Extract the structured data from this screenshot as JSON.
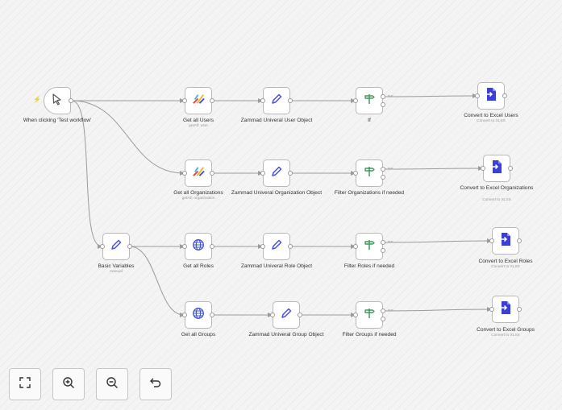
{
  "nodes": {
    "trigger": {
      "label": "When clicking 'Test workflow'",
      "icon": "cursor-icon"
    },
    "get_users": {
      "label": "Get all Users",
      "sub": "getAll: user",
      "icon": "zammad-logo-icon"
    },
    "zam_user": {
      "label": "Zammad Univeral User Object",
      "icon": "pencil-icon"
    },
    "if_node": {
      "label": "If",
      "icon": "signpost-icon"
    },
    "xl_users": {
      "label": "Convert to Excel Users",
      "sub": "Convert to XLSX",
      "icon": "file-convert-icon"
    },
    "get_orgs": {
      "label": "Get all Organizations",
      "sub": "getAll: organization",
      "icon": "zammad-logo-icon"
    },
    "zam_org": {
      "label": "Zammad Univeral Organization Object",
      "icon": "pencil-icon"
    },
    "filter_orgs": {
      "label": "Filter Organizations if needed",
      "icon": "signpost-icon"
    },
    "xl_orgs": {
      "label": "Convert to Excel Organizations",
      "sub": "Convert to XLSX",
      "icon": "file-convert-icon"
    },
    "basic_vars": {
      "label": "Basic Variables",
      "sub": "manual",
      "icon": "pencil-icon"
    },
    "get_roles": {
      "label": "Get all Roles",
      "icon": "globe-icon"
    },
    "zam_role": {
      "label": "Zammad Univeral Role Object",
      "icon": "pencil-icon"
    },
    "filter_roles": {
      "label": "Filter Roles if needed",
      "icon": "signpost-icon"
    },
    "xl_roles": {
      "label": "Convert to Excel Roles",
      "sub": "Convert to XLSX",
      "icon": "file-convert-icon"
    },
    "get_groups": {
      "label": "Get all Groups",
      "icon": "globe-icon"
    },
    "zam_group": {
      "label": "Zammad Univeral Group Object",
      "icon": "pencil-icon"
    },
    "filter_groups": {
      "label": "Filter Groups if needed",
      "icon": "signpost-icon"
    },
    "xl_groups": {
      "label": "Convert to Excel Groups",
      "sub": "Convert to XLSX",
      "icon": "file-convert-icon"
    }
  },
  "branch": {
    "true_label": "true"
  },
  "controls": [
    {
      "name": "zoom-to-fit-button",
      "icon": "fit-view-icon"
    },
    {
      "name": "zoom-in-button",
      "icon": "zoom-in-icon"
    },
    {
      "name": "zoom-out-button",
      "icon": "zoom-out-icon"
    },
    {
      "name": "undo-button",
      "icon": "undo-icon"
    }
  ],
  "colors": {
    "edge": "#9b9b9b",
    "pencil": "#4b50e6",
    "signpost": "#3f9a5a",
    "file": "#3b3fd8",
    "globe": "#3d53d6",
    "bolt": "#e4572e"
  }
}
